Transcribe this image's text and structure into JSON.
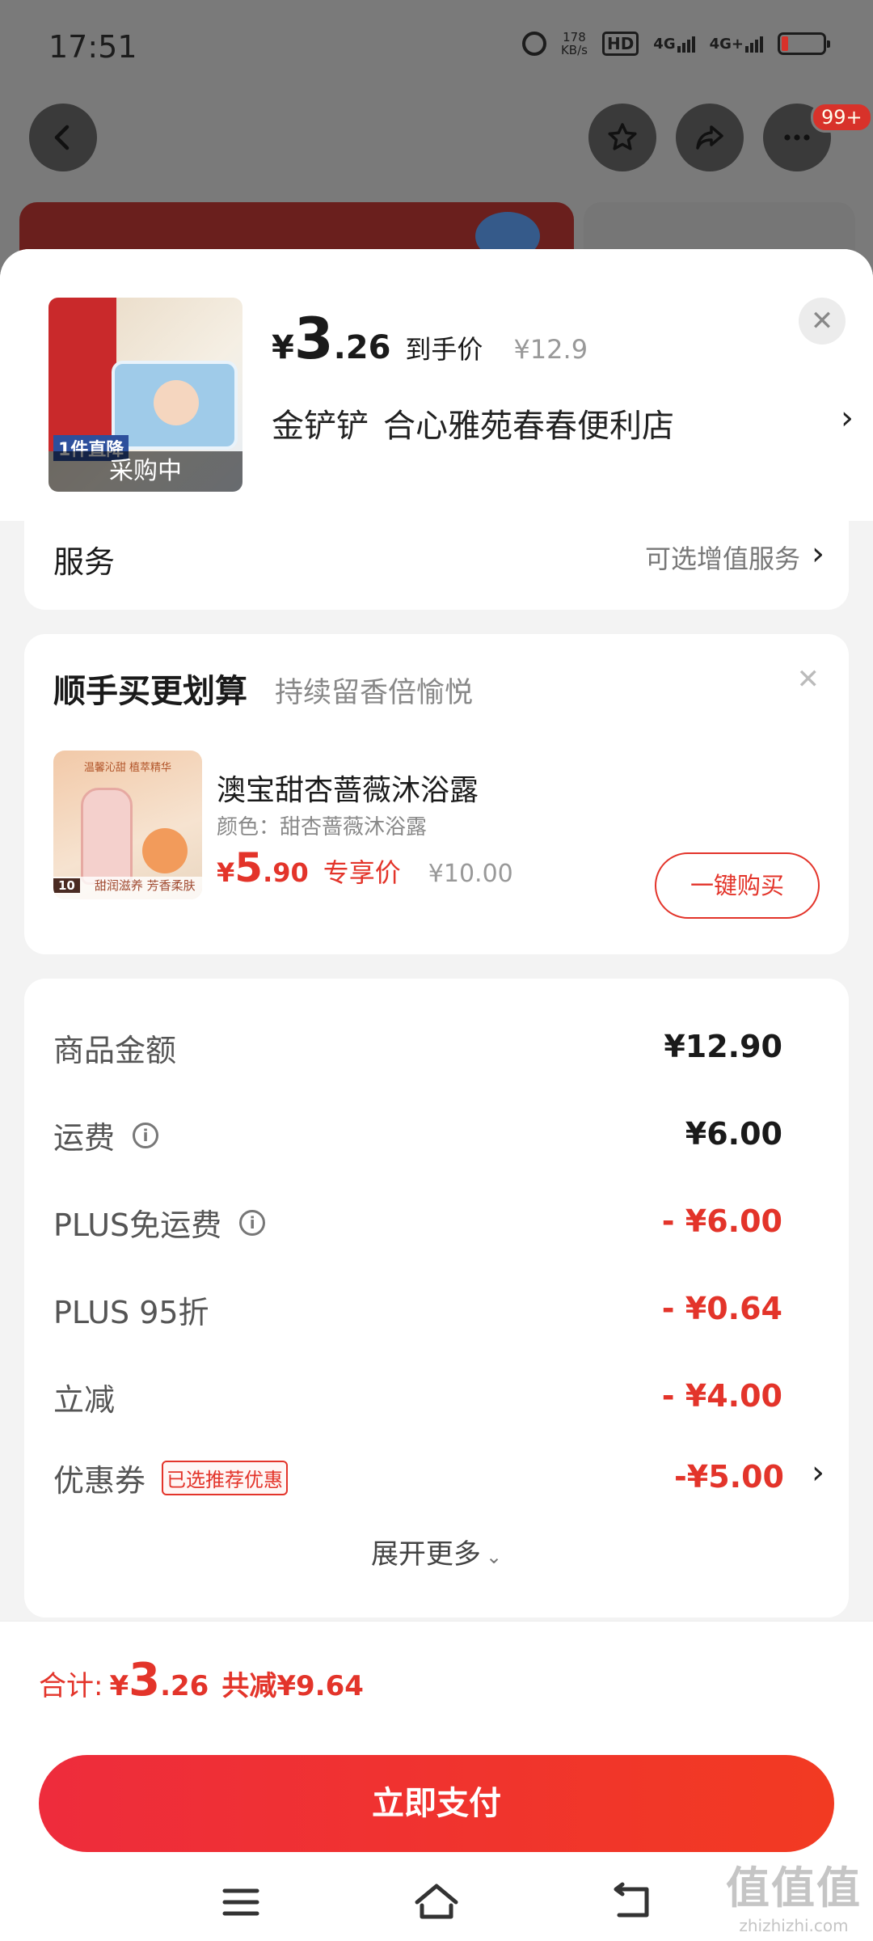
{
  "status_bar": {
    "time": "17:51",
    "speed_value": "178",
    "speed_unit": "KB/s",
    "hd": "HD",
    "net1": "4G",
    "net2": "4G+"
  },
  "header": {
    "back_icon": "chevron-left-icon",
    "favorite_icon": "star-icon",
    "share_icon": "share-icon",
    "more_icon": "more-icon",
    "more_badge": "99+"
  },
  "product": {
    "image_overlay": "采购中",
    "image_tag": "1件直降",
    "currency": "¥",
    "price_int": "3",
    "price_dec": ".26",
    "price_label": "到手价",
    "original_price": "¥12.9",
    "shop_prefix": "金铲铲",
    "shop_name": "合心雅苑春春便利店",
    "chevron": "›",
    "close": "✕"
  },
  "service": {
    "label": "服务",
    "hint": "可选增值服务",
    "chevron": "›"
  },
  "upsell": {
    "title": "顺手买更划算",
    "subtitle": "持续留香倍愉悦",
    "close": "✕",
    "image_caption": "温馨沁甜 植萃精华",
    "image_volume": "10",
    "image_footer": "甜润滋养 芳香柔肤",
    "name": "澳宝甜杏蔷薇沐浴露",
    "color": "颜色：甜杏蔷薇沐浴露",
    "currency": "¥",
    "price_int": "5",
    "price_dec": ".90",
    "price_label": "专享价",
    "original_price": "¥10.00",
    "button": "一键购买"
  },
  "fees": {
    "rows": [
      {
        "label": "商品金额",
        "value": "¥12.90"
      },
      {
        "label": "运费",
        "value": "¥6.00"
      },
      {
        "label": "PLUS免运费",
        "value": "- ¥6.00"
      },
      {
        "label": "PLUS 95折",
        "value": "- ¥0.64"
      },
      {
        "label": "立减",
        "value": "- ¥4.00"
      },
      {
        "label": "优惠券",
        "tag": "已选推荐优惠",
        "value": "-¥5.00"
      }
    ],
    "info_icon": "i",
    "chevron": "›",
    "expand_label": "展开更多",
    "expand_icon": "⌄"
  },
  "total": {
    "label": "合计:",
    "currency": "¥",
    "price_int": "3",
    "price_dec": ".26",
    "discount": "共减¥9.64"
  },
  "pay_button": "立即支付",
  "watermark": {
    "line1": "值值值",
    "line2": "zhizhizhi.com"
  },
  "colors": {
    "accent_red": "#e3342a",
    "pay_gradient_start": "#ee2c3c",
    "pay_gradient_end": "#f23a22"
  }
}
